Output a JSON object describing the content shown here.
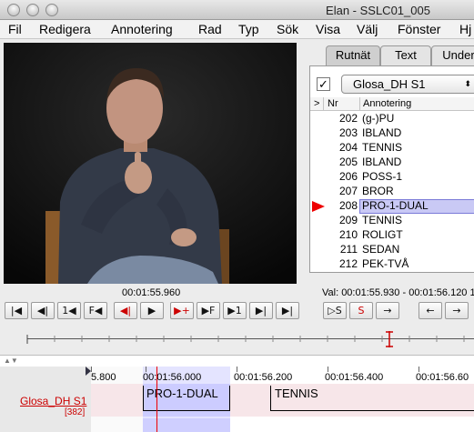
{
  "window": {
    "title": "Elan - SSLC01_005"
  },
  "menu": [
    "Fil",
    "Redigera",
    "Annotering",
    "Rad",
    "Typ",
    "Sök",
    "Visa",
    "Välj",
    "Fönster",
    "Hj"
  ],
  "tabs": [
    {
      "label": "Rutnät",
      "active": true
    },
    {
      "label": "Text",
      "active": false
    },
    {
      "label": "Under",
      "active": false
    }
  ],
  "grid": {
    "tier_checked": "✓",
    "tier_name": "Glosa_DH S1",
    "col_arrow": ">",
    "col_nr": "Nr",
    "col_annotation": "Annotering",
    "rows": [
      {
        "nr": "202",
        "annotation": "(g-)PU"
      },
      {
        "nr": "203",
        "annotation": "IBLAND"
      },
      {
        "nr": "204",
        "annotation": "TENNIS"
      },
      {
        "nr": "205",
        "annotation": "IBLAND"
      },
      {
        "nr": "206",
        "annotation": "POSS-1"
      },
      {
        "nr": "207",
        "annotation": "BROR"
      },
      {
        "nr": "208",
        "annotation": "PRO-1-DUAL"
      },
      {
        "nr": "209",
        "annotation": "TENNIS"
      },
      {
        "nr": "210",
        "annotation": "ROLIGT"
      },
      {
        "nr": "211",
        "annotation": "SEDAN"
      },
      {
        "nr": "212",
        "annotation": "PEK-TVÅ"
      }
    ]
  },
  "time": {
    "current": "00:01:55.960",
    "selection": "Val: 00:01:55.930 - 00:01:56.120  1"
  },
  "controls": {
    "left": [
      "|◀",
      "◀|",
      "1◀",
      "F◀",
      "◀|",
      "▶",
      "▶+",
      "▶F",
      "▶1",
      "▶|",
      "▶|"
    ],
    "right": [
      "▷S",
      "S",
      "→",
      "←",
      "→"
    ]
  },
  "timeline": {
    "ticks": [
      "5.800",
      "00:01:56.000",
      "00:01:56.200",
      "00:01:56.400",
      "00:01:56.60"
    ],
    "tier_label": "Glosa_DH S1",
    "tier_count": "[382]",
    "annotations": [
      "PRO-1-DUAL",
      "TENNIS"
    ]
  },
  "colors": {
    "selection": "#c9c9f5",
    "cursor": "#e00000",
    "tier_label": "#cc0000"
  }
}
